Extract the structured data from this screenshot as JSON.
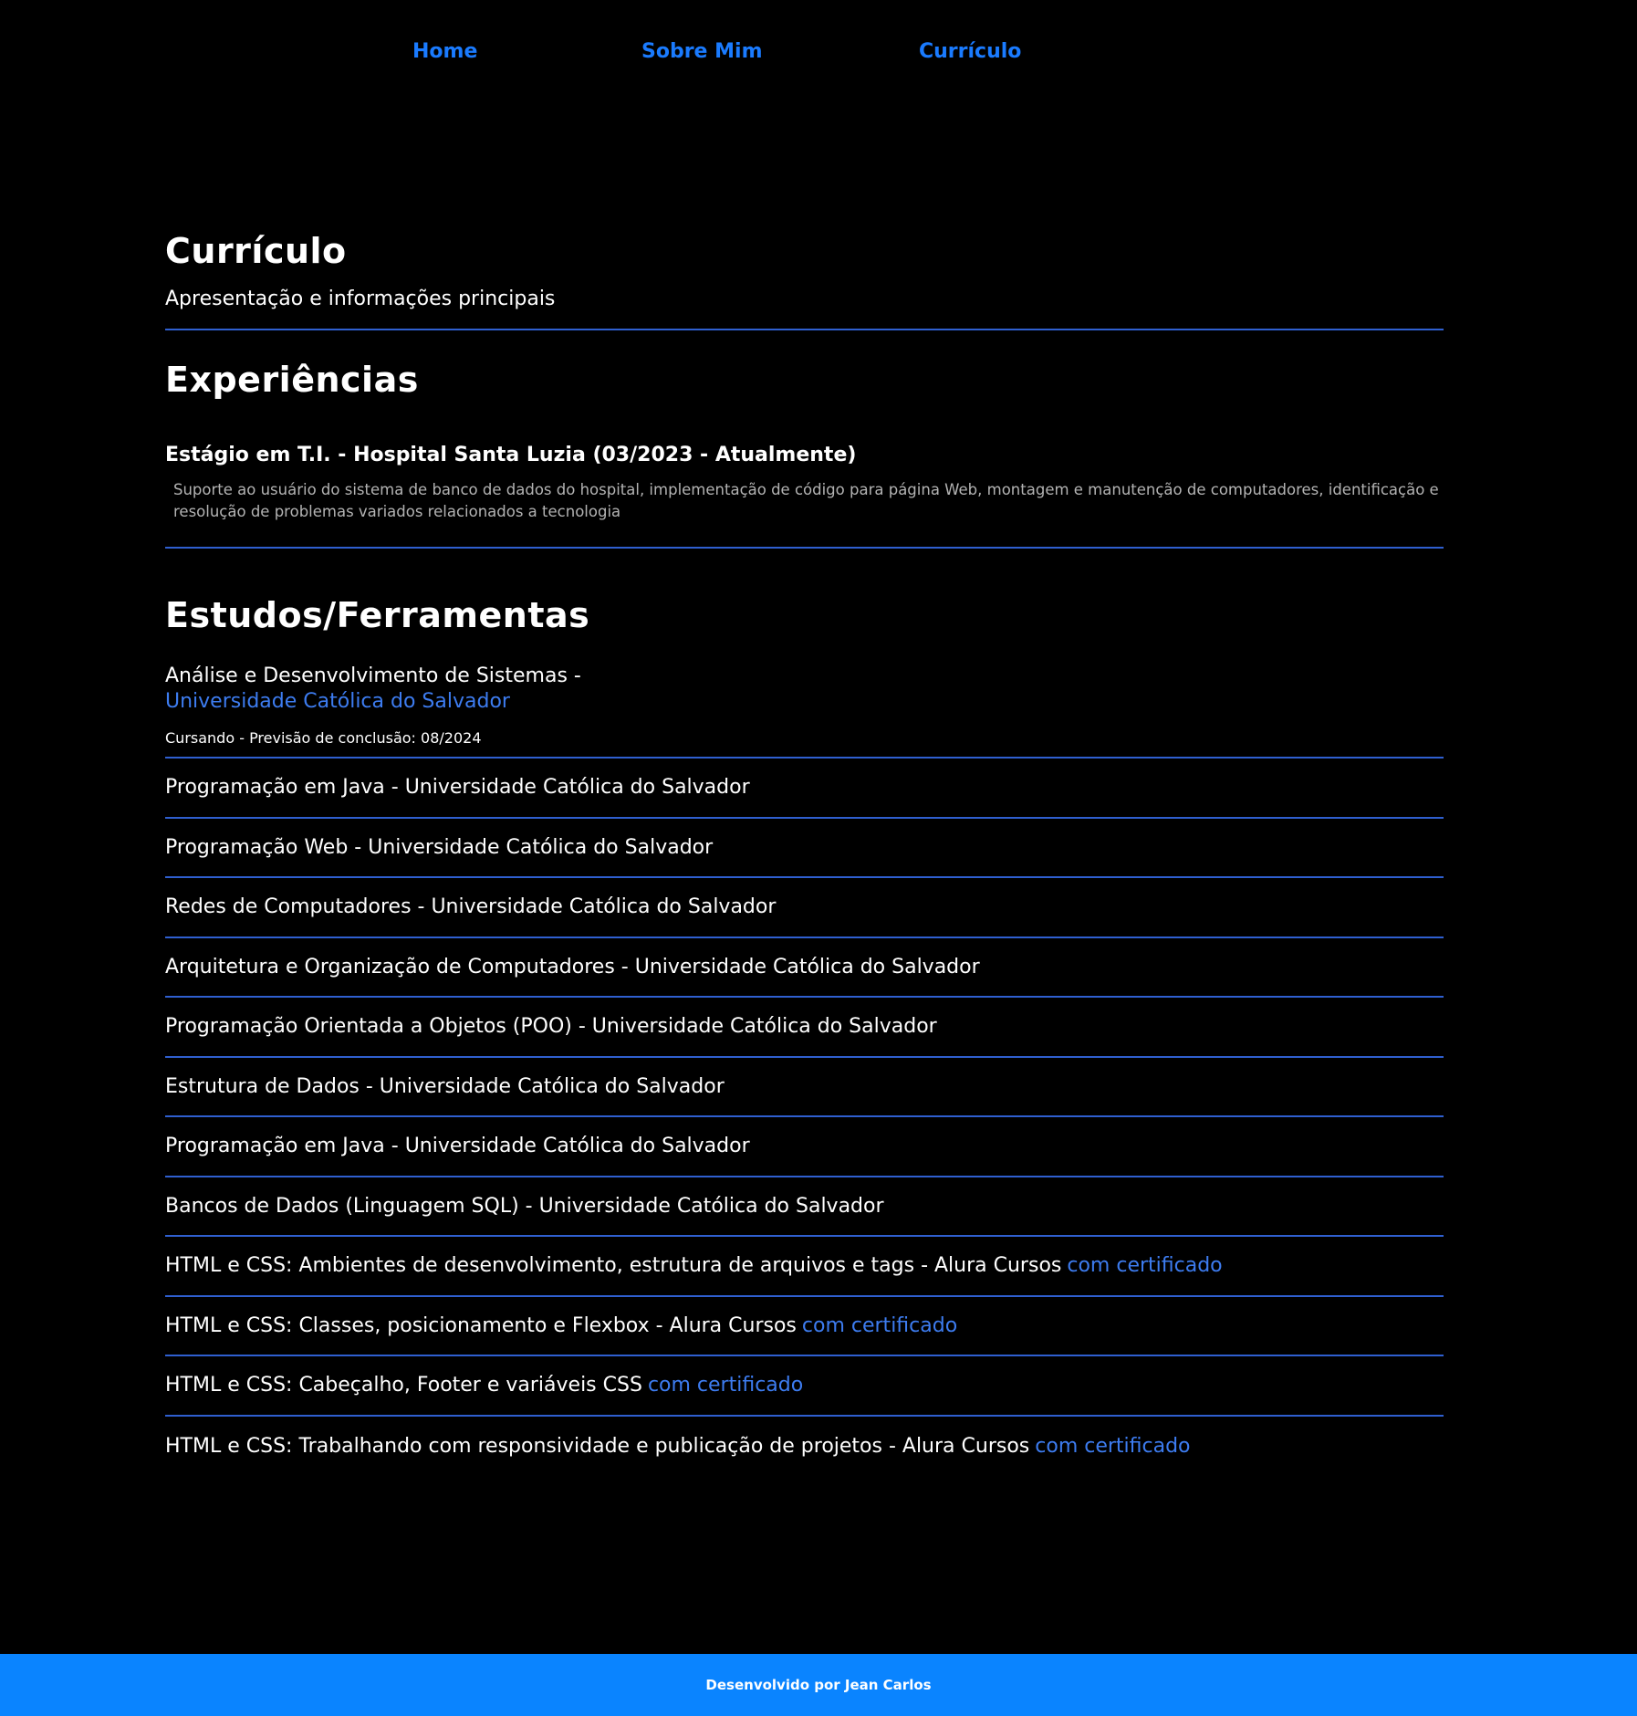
{
  "nav": {
    "items": [
      {
        "label": "Home"
      },
      {
        "label": "Sobre Mim"
      },
      {
        "label": "Currículo"
      }
    ],
    "link_color": "#1a7bff"
  },
  "header": {
    "title": "Currículo",
    "subtitle": "Apresentação e informações principais"
  },
  "experiences": {
    "title": "Experiências",
    "items": [
      {
        "title": "Estágio em T.I. - Hospital Santa Luzia (03/2023 - Atualmente)",
        "description": "Suporte ao usuário do sistema de banco de dados do hospital, implementação de código para página Web, montagem e manutenção de computadores, identificação e resolução de problemas variados relacionados a tecnologia"
      }
    ]
  },
  "studies": {
    "title": "Estudos/Ferramentas",
    "main": {
      "title": "Análise e Desenvolvimento de Sistemas -",
      "link": "Universidade Católica do Salvador",
      "status": "Cursando - Previsão de conclusão: 08/2024"
    },
    "items": [
      {
        "text": "Programação em Java - Universidade Católica do Salvador",
        "cert": ""
      },
      {
        "text": "Programação Web - Universidade Católica do Salvador",
        "cert": ""
      },
      {
        "text": "Redes de Computadores - Universidade Católica do Salvador",
        "cert": ""
      },
      {
        "text": "Arquitetura e Organização de Computadores - Universidade Católica do Salvador",
        "cert": ""
      },
      {
        "text": "Programação Orientada a Objetos (POO) - Universidade Católica do Salvador",
        "cert": ""
      },
      {
        "text": "Estrutura de Dados - Universidade Católica do Salvador",
        "cert": ""
      },
      {
        "text": "Programação em Java - Universidade Católica do Salvador",
        "cert": ""
      },
      {
        "text": "Bancos de Dados (Linguagem SQL) - Universidade Católica do Salvador",
        "cert": ""
      },
      {
        "text": "HTML e CSS: Ambientes de desenvolvimento, estrutura de arquivos e tags - Alura Cursos",
        "cert": "com certificado"
      },
      {
        "text": "HTML e CSS: Classes, posicionamento e Flexbox - Alura Cursos",
        "cert": "com certificado"
      },
      {
        "text": "HTML e CSS: Cabeçalho, Footer e variáveis CSS",
        "cert": "com certificado"
      },
      {
        "text": "HTML e CSS: Trabalhando com responsividade e publicação de projetos - Alura Cursos",
        "cert": "com certificado"
      }
    ]
  },
  "footer": {
    "text": "Desenvolvido por Jean Carlos",
    "background": "#0a84ff"
  },
  "colors": {
    "background": "#000000",
    "accent_link": "#3d7cf0",
    "divider": "#2f5fcf"
  }
}
